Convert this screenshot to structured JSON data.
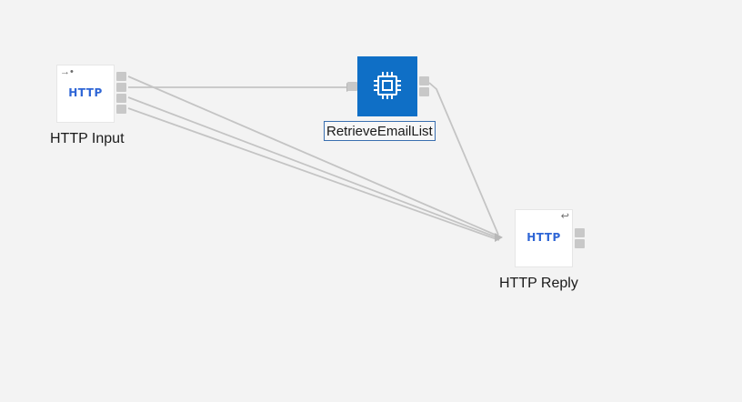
{
  "nodes": {
    "http_input": {
      "icon_text": "HTTP",
      "caption": "HTTP Input",
      "icon": "input-arrow-icon"
    },
    "retrieve": {
      "caption": "RetrieveEmailList",
      "icon": "chip-icon"
    },
    "http_reply": {
      "icon_text": "HTTP",
      "caption": "HTTP Reply",
      "icon": "reply-arrow-icon"
    }
  },
  "colors": {
    "canvas": "#f3f3f3",
    "wire": "#c4c4c4",
    "compute_fill": "#0f6fc6",
    "http_text": "#2f66d6"
  }
}
